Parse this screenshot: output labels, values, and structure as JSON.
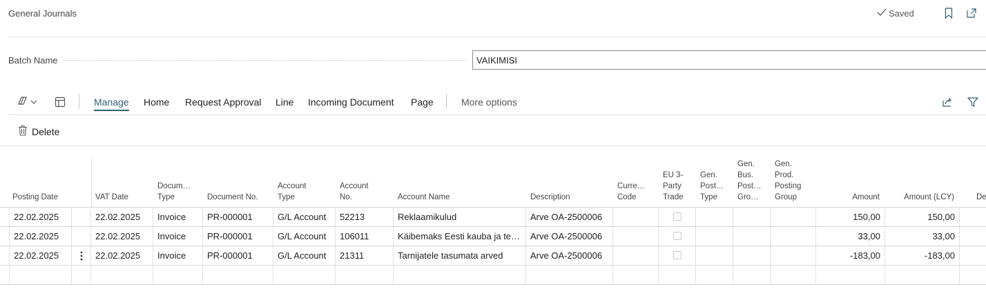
{
  "page": {
    "title": "General Journals",
    "saved_label": "Saved"
  },
  "batch": {
    "label": "Batch Name",
    "value": "VAIKIMISI"
  },
  "actionbar": {
    "tabs": [
      {
        "label": "Manage",
        "active": true
      },
      {
        "label": "Home"
      },
      {
        "label": "Request Approval"
      },
      {
        "label": "Line"
      },
      {
        "label": "Incoming Document"
      },
      {
        "label": "Page"
      }
    ],
    "more_options": "More options",
    "delete_label": "Delete"
  },
  "table": {
    "headers": {
      "posting_date": [
        "Posting Date"
      ],
      "vat_date": [
        "VAT Date"
      ],
      "document_type": [
        "Docum…",
        "Type"
      ],
      "document_no": [
        "Document No."
      ],
      "account_type": [
        "Account",
        "Type"
      ],
      "account_no": [
        "Account",
        "No."
      ],
      "account_name": [
        "Account Name"
      ],
      "description": [
        "Description"
      ],
      "currency_code": [
        "Curre…",
        "Code"
      ],
      "eu_3_party": [
        "EU 3-",
        "Party",
        "Trade"
      ],
      "gen_post_type": [
        "Gen.",
        "Post…",
        "Type"
      ],
      "gen_bus_post_group": [
        "Gen.",
        "Bus.",
        "Post…",
        "Gro…"
      ],
      "gen_prod_posting_group": [
        "Gen.",
        "Prod.",
        "Posting",
        "Group"
      ],
      "amount": [
        "Amount"
      ],
      "amount_lcy": [
        "Amount (LCY)"
      ],
      "trailing": [
        "De"
      ]
    },
    "rows": [
      {
        "posting_date": "22.02.2025",
        "vat_date": "22.02.2025",
        "document_type": "Invoice",
        "document_no": "PR-000001",
        "account_type": "G/L Account",
        "account_no": "52213",
        "account_name": "Reklaamikulud",
        "description": "Arve OA-2500006",
        "amount": "150,00",
        "amount_lcy": "150,00",
        "selected": false
      },
      {
        "posting_date": "22.02.2025",
        "vat_date": "22.02.2025",
        "document_type": "Invoice",
        "document_no": "PR-000001",
        "account_type": "G/L Account",
        "account_no": "106011",
        "account_name": "Käibemaks Eesti kauba ja te…",
        "description": "Arve OA-2500006",
        "amount": "33,00",
        "amount_lcy": "33,00",
        "selected": false
      },
      {
        "posting_date": "22.02.2025",
        "vat_date": "22.02.2025",
        "document_type": "Invoice",
        "document_no": "PR-000001",
        "account_type": "G/L Account",
        "account_no": "21311",
        "account_name": "Tarnijatele tasumata arved",
        "description": "Arve OA-2500006",
        "amount": "-183,00",
        "amount_lcy": "-183,00",
        "selected": true
      }
    ]
  }
}
